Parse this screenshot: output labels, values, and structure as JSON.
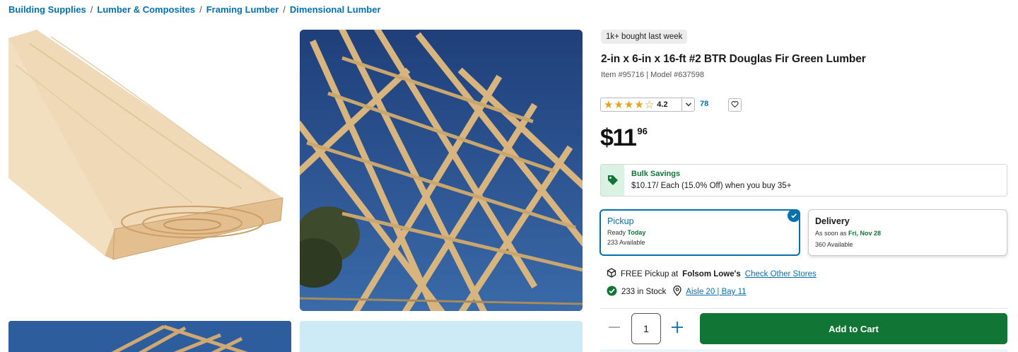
{
  "breadcrumb": [
    "Building Supplies",
    "Lumber & Composites",
    "Framing Lumber",
    "Dimensional Lumber"
  ],
  "breadcrumb_separator": "/",
  "product": {
    "badge": "1k+ bought last week",
    "title": "2-in x 6-in x 16-ft #2 BTR Douglas Fir Green Lumber",
    "item_line": "Item #95716 | Model #637598",
    "rating": "4.2",
    "rating_stars": 4,
    "review_count": "78",
    "price_dollars": "$11",
    "price_cents": "96"
  },
  "bulk": {
    "title": "Bulk Savings",
    "description": "$10.17/ Each (15.0% Off) when you buy 35+"
  },
  "fulfillment": {
    "pickup": {
      "title": "Pickup",
      "ready_prefix": "Ready",
      "ready_value": "Today",
      "available": "233 Available",
      "selected": true
    },
    "delivery": {
      "title": "Delivery",
      "soon_prefix": "As soon as",
      "soon_value": "Fri, Nov 28",
      "available": "360 Available",
      "selected": false
    }
  },
  "store": {
    "free_pickup_prefix": "FREE Pickup at",
    "store_name": "Folsom Lowe's",
    "check_link": "Check Other Stores",
    "stock": "233 in Stock",
    "aisle": "Aisle 20 | Bay 11"
  },
  "cart": {
    "quantity": "1",
    "add_label": "Add to Cart"
  },
  "colors": {
    "link_blue": "#0471af",
    "brand_green": "#117535",
    "star": "#e8a317"
  },
  "icons": [
    "tag-icon",
    "chevron-down-icon",
    "heart-icon",
    "checkmark-icon",
    "store-box-icon",
    "in-stock-check-icon",
    "location-pin-icon",
    "minus-icon",
    "plus-icon"
  ]
}
